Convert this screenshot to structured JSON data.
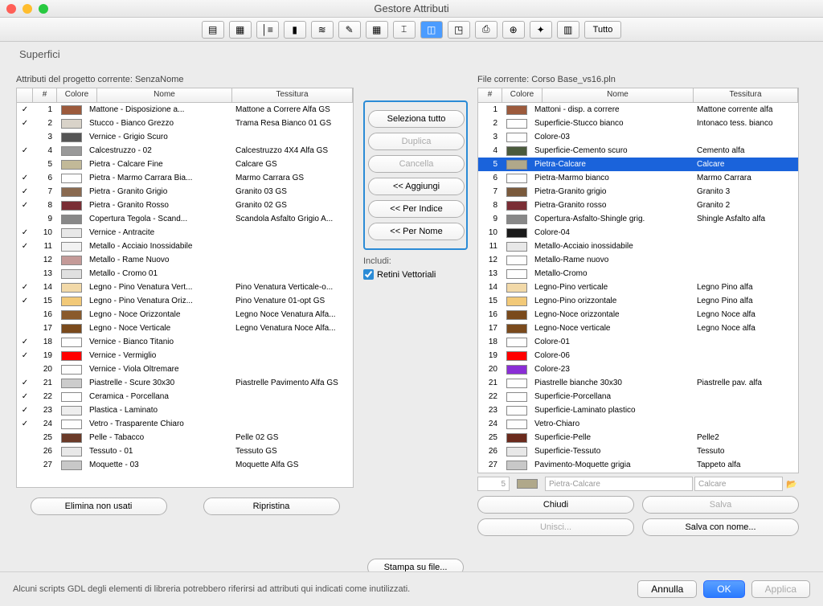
{
  "window_title": "Gestore Attributi",
  "toolbar_all": "Tutto",
  "section_title": "Superfici",
  "left": {
    "label": "Attributi del progetto corrente: SenzaNome",
    "cols": {
      "check": "",
      "num": "#",
      "color": "Colore",
      "name": "Nome",
      "tex": "Tessitura"
    },
    "rows": [
      {
        "c": "✓",
        "n": "1",
        "color": "#9c5a3c",
        "name": "Mattone - Disposizione a...",
        "tex": "Mattone a Correre Alfa GS"
      },
      {
        "c": "✓",
        "n": "2",
        "color": "#d9d3c9",
        "name": "Stucco - Bianco Grezzo",
        "tex": "Trama Resa Bianco 01 GS"
      },
      {
        "c": "",
        "n": "3",
        "color": "#555555",
        "name": "Vernice - Grigio Scuro",
        "tex": ""
      },
      {
        "c": "✓",
        "n": "4",
        "color": "#999999",
        "name": "Calcestruzzo - 02",
        "tex": "Calcestruzzo 4X4 Alfa GS"
      },
      {
        "c": "",
        "n": "5",
        "color": "#c2b998",
        "name": "Pietra - Calcare Fine",
        "tex": "Calcare GS"
      },
      {
        "c": "✓",
        "n": "6",
        "color": "#fefefe",
        "name": "Pietra - Marmo Carrara Bia...",
        "tex": "Marmo Carrara GS"
      },
      {
        "c": "✓",
        "n": "7",
        "color": "#8a6a50",
        "name": "Pietra - Granito Grigio",
        "tex": "Granito 03 GS"
      },
      {
        "c": "✓",
        "n": "8",
        "color": "#7a2e35",
        "name": "Pietra - Granito Rosso",
        "tex": "Granito 02 GS"
      },
      {
        "c": "",
        "n": "9",
        "color": "#888888",
        "name": "Copertura Tegola - Scand...",
        "tex": "Scandola Asfalto Grigio A..."
      },
      {
        "c": "✓",
        "n": "10",
        "color": "#e8e8e8",
        "name": "Vernice - Antracite",
        "tex": ""
      },
      {
        "c": "✓",
        "n": "11",
        "color": "#f2f2f2",
        "name": "Metallo - Acciaio Inossidabile",
        "tex": ""
      },
      {
        "c": "",
        "n": "12",
        "color": "#c49a98",
        "name": "Metallo - Rame Nuovo",
        "tex": ""
      },
      {
        "c": "",
        "n": "13",
        "color": "#e0e0e0",
        "name": "Metallo - Cromo 01",
        "tex": ""
      },
      {
        "c": "✓",
        "n": "14",
        "color": "#f2d9a8",
        "name": "Legno - Pino Venatura Vert...",
        "tex": "Pino Venatura Verticale-o..."
      },
      {
        "c": "✓",
        "n": "15",
        "color": "#f2c978",
        "name": "Legno - Pino Venatura Oriz...",
        "tex": "Pino Venature 01-opt GS"
      },
      {
        "c": "",
        "n": "16",
        "color": "#8a5a2c",
        "name": "Legno - Noce Orizzontale",
        "tex": "Legno Noce Venatura Alfa..."
      },
      {
        "c": "",
        "n": "17",
        "color": "#7a4a1c",
        "name": "Legno - Noce Verticale",
        "tex": "Legno Venatura Noce Alfa..."
      },
      {
        "c": "✓",
        "n": "18",
        "color": "#fefefe",
        "name": "Vernice - Bianco Titanio",
        "tex": ""
      },
      {
        "c": "✓",
        "n": "19",
        "color": "#ff0000",
        "name": "Vernice - Vermiglio",
        "tex": ""
      },
      {
        "c": "",
        "n": "20",
        "color": "#fefefe",
        "name": "Vernice - Viola Oltremare",
        "tex": ""
      },
      {
        "c": "✓",
        "n": "21",
        "color": "#cccccc",
        "name": "Piastrelle - Scure 30x30",
        "tex": "Piastrelle Pavimento Alfa GS"
      },
      {
        "c": "✓",
        "n": "22",
        "color": "#fefefe",
        "name": "Ceramica - Porcellana",
        "tex": ""
      },
      {
        "c": "✓",
        "n": "23",
        "color": "#eeeeee",
        "name": "Plastica - Laminato",
        "tex": ""
      },
      {
        "c": "✓",
        "n": "24",
        "color": "#fefefe",
        "name": "Vetro - Trasparente Chiaro",
        "tex": ""
      },
      {
        "c": "",
        "n": "25",
        "color": "#6a3a28",
        "name": "Pelle - Tabacco",
        "tex": "Pelle 02 GS"
      },
      {
        "c": "",
        "n": "26",
        "color": "#e8e8e8",
        "name": "Tessuto - 01",
        "tex": "Tessuto GS"
      },
      {
        "c": "",
        "n": "27",
        "color": "#c8c8c8",
        "name": "Moquette - 03",
        "tex": "Moquette Alfa GS"
      }
    ],
    "btn_delete_unused": "Elimina non usati",
    "btn_restore": "Ripristina"
  },
  "mid": {
    "select_all": "Seleziona tutto",
    "duplicate": "Duplica",
    "delete": "Cancella",
    "add": "<< Aggiungi",
    "by_index": "<< Per Indice",
    "by_name": "<< Per Nome",
    "include": "Includi:",
    "vector_fills": "Retini Vettoriali",
    "print_to_file": "Stampa su file..."
  },
  "right": {
    "label": "File corrente: Corso Base_vs16.pln",
    "cols": {
      "num": "#",
      "color": "Colore",
      "name": "Nome",
      "tex": "Tessitura"
    },
    "rows": [
      {
        "n": "1",
        "color": "#9c5a3c",
        "name": "Mattoni - disp. a correre",
        "tex": "Mattone corrente alfa"
      },
      {
        "n": "2",
        "color": "#fefefe",
        "name": "Superficie-Stucco bianco",
        "tex": "Intonaco tess. bianco"
      },
      {
        "n": "3",
        "color": "#fefefe",
        "name": "Colore-03",
        "tex": ""
      },
      {
        "n": "4",
        "color": "#4a5a3c",
        "name": "Superficie-Cemento scuro",
        "tex": "Cemento alfa"
      },
      {
        "n": "5",
        "color": "#b0a88a",
        "name": "Pietra-Calcare",
        "tex": "Calcare",
        "selected": true
      },
      {
        "n": "6",
        "color": "#fefefe",
        "name": "Pietra-Marmo bianco",
        "tex": "Marmo Carrara"
      },
      {
        "n": "7",
        "color": "#7a5a3c",
        "name": "Pietra-Granito grigio",
        "tex": "Granito 3"
      },
      {
        "n": "8",
        "color": "#7a2e35",
        "name": "Pietra-Granito rosso",
        "tex": "Granito 2"
      },
      {
        "n": "9",
        "color": "#888888",
        "name": "Copertura-Asfalto-Shingle grig.",
        "tex": "Shingle Asfalto alfa"
      },
      {
        "n": "10",
        "color": "#1a1a1a",
        "name": "Colore-04",
        "tex": ""
      },
      {
        "n": "11",
        "color": "#e8e8e8",
        "name": "Metallo-Acciaio inossidabile",
        "tex": ""
      },
      {
        "n": "12",
        "color": "#fefefe",
        "name": "Metallo-Rame nuovo",
        "tex": ""
      },
      {
        "n": "13",
        "color": "#fefefe",
        "name": "Metallo-Cromo",
        "tex": ""
      },
      {
        "n": "14",
        "color": "#f2d9a8",
        "name": "Legno-Pino verticale",
        "tex": "Legno Pino alfa"
      },
      {
        "n": "15",
        "color": "#f2c978",
        "name": "Legno-Pino orizzontale",
        "tex": "Legno Pino alfa"
      },
      {
        "n": "16",
        "color": "#7a4a1c",
        "name": "Legno-Noce orizzontale",
        "tex": "Legno Noce alfa"
      },
      {
        "n": "17",
        "color": "#7a4a1c",
        "name": "Legno-Noce verticale",
        "tex": "Legno Noce alfa"
      },
      {
        "n": "18",
        "color": "#fefefe",
        "name": "Colore-01",
        "tex": ""
      },
      {
        "n": "19",
        "color": "#ff0000",
        "name": "Colore-06",
        "tex": ""
      },
      {
        "n": "20",
        "color": "#8a2ed6",
        "name": "Colore-23",
        "tex": ""
      },
      {
        "n": "21",
        "color": "#fefefe",
        "name": "Piastrelle bianche 30x30",
        "tex": "Piastrelle pav. alfa"
      },
      {
        "n": "22",
        "color": "#fefefe",
        "name": "Superficie-Porcellana",
        "tex": ""
      },
      {
        "n": "23",
        "color": "#fefefe",
        "name": "Superficie-Laminato plastico",
        "tex": ""
      },
      {
        "n": "24",
        "color": "#fefefe",
        "name": "Vetro-Chiaro",
        "tex": ""
      },
      {
        "n": "25",
        "color": "#6a2a1c",
        "name": "Superficie-Pelle",
        "tex": "Pelle2"
      },
      {
        "n": "26",
        "color": "#e8e8e8",
        "name": "Superficie-Tessuto",
        "tex": "Tessuto"
      },
      {
        "n": "27",
        "color": "#c8c8c8",
        "name": "Pavimento-Moquette grigia",
        "tex": "Tappeto alfa"
      }
    ],
    "input_num": "5",
    "input_name": "Pietra-Calcare",
    "input_tex": "Calcare",
    "btn_close": "Chiudi",
    "btn_save": "Salva",
    "btn_merge": "Unisci...",
    "btn_save_as": "Salva con nome..."
  },
  "footer": {
    "text": "Alcuni scripts GDL degli elementi di libreria potrebbero riferirsi ad attributi qui indicati come inutilizzati.",
    "cancel": "Annulla",
    "ok": "OK",
    "apply": "Applica"
  }
}
